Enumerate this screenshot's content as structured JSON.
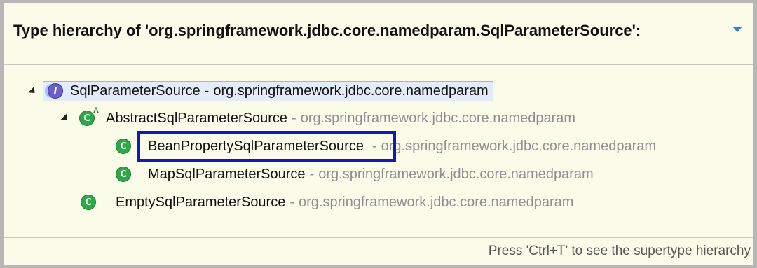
{
  "header": {
    "title": "Type hierarchy of 'org.springframework.jdbc.core.namedparam.SqlParameterSource':",
    "menu_icon": "view-menu-arrow-icon"
  },
  "tree": {
    "root": {
      "name": "SqlParameterSource",
      "separator": "-",
      "package": "org.springframework.jdbc.core.namedparam",
      "icon": "interface-icon",
      "selected": true
    },
    "abstract_node": {
      "name": "AbstractSqlParameterSource",
      "separator": "-",
      "package": "org.springframework.jdbc.core.namedparam",
      "icon": "abstract-class-icon",
      "abstract_marker": "A"
    },
    "children": [
      {
        "name": "BeanPropertySqlParameterSource",
        "separator": "-",
        "package": "org.springframework.jdbc.core.namedparam",
        "icon": "class-icon",
        "highlighted": true
      },
      {
        "name": "MapSqlParameterSource",
        "separator": "-",
        "package": "org.springframework.jdbc.core.namedparam",
        "icon": "class-icon"
      }
    ],
    "sibling": {
      "name": "EmptySqlParameterSource",
      "separator": "-",
      "package": "org.springframework.jdbc.core.namedparam",
      "icon": "class-icon"
    }
  },
  "footer": {
    "hint": "Press 'Ctrl+T' to see the supertype hierarchy"
  },
  "colors": {
    "background": "#fbfbe9",
    "highlight_box": "#1019b9",
    "package_text": "#8f8f8f",
    "class_icon": "#2fa84a",
    "interface_icon": "#6b5fc8"
  }
}
